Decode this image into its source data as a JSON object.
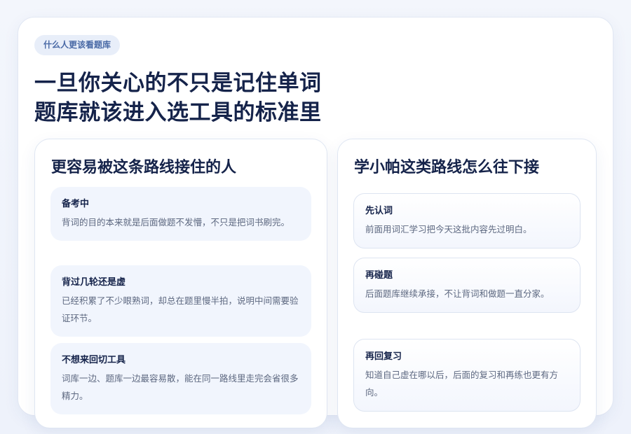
{
  "tag": "什么人更该看题库",
  "headline": {
    "line1": "一旦你关心的不只是记住单词",
    "line2": "题库就该进入选工具的标准里"
  },
  "left_panel": {
    "title": "更容易被这条路线接住的人",
    "cards": [
      {
        "title": "备考中",
        "desc": "背词的目的本来就是后面做题不发懵，不只是把词书刷完。"
      },
      {
        "title": "背过几轮还是虚",
        "desc": "已经积累了不少眼熟词，却总在题里慢半拍，说明中间需要验证环节。"
      },
      {
        "title": "不想来回切工具",
        "desc": "词库一边、题库一边最容易散，能在同一路线里走完会省很多精力。"
      }
    ]
  },
  "right_panel": {
    "title": "学小帕这类路线怎么往下接",
    "cards": [
      {
        "title": "先认词",
        "desc": "前面用词汇学习把今天这批内容先过明白。"
      },
      {
        "title": "再碰题",
        "desc": "后面题库继续承接，不让背词和做题一直分家。"
      },
      {
        "title": "再回复习",
        "desc": "知道自己虚在哪以后，后面的复习和再练也更有方向。"
      }
    ]
  }
}
